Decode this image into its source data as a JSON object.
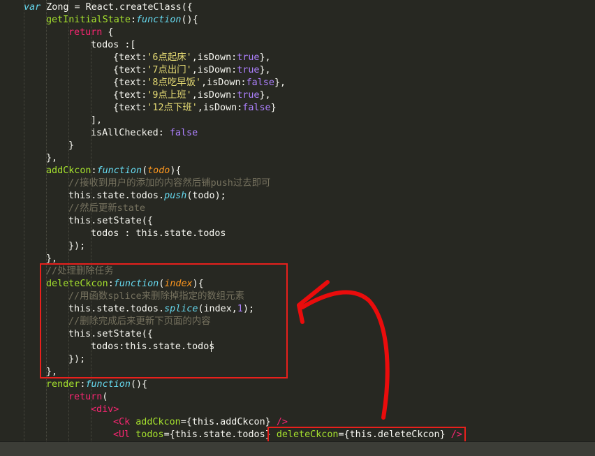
{
  "editor": {
    "theme_colors": {
      "background": "#272822",
      "keyword": "#f92672",
      "function_name": "#a6e22e",
      "string": "#e6db74",
      "constant": "#ae81ff",
      "comment": "#75715e",
      "parameter": "#fd971f",
      "storage": "#66d9ef",
      "annotation": "#e8201c"
    },
    "lines": [
      [
        [
          "st",
          "var"
        ],
        [
          "def",
          " Zong = React.createClass({"
        ]
      ],
      [
        [
          "fn",
          "getInitialState"
        ],
        [
          "def",
          ":"
        ],
        [
          "st",
          "function"
        ],
        [
          "def",
          "(){"
        ]
      ],
      [
        [
          "kw",
          "return"
        ],
        [
          "def",
          " {"
        ]
      ],
      [
        [
          "def",
          "todos :["
        ]
      ],
      [
        [
          "def",
          "{text:"
        ],
        [
          "str",
          "'6点起床'"
        ],
        [
          "def",
          ",isDown:"
        ],
        [
          "num",
          "true"
        ],
        [
          "def",
          "},"
        ]
      ],
      [
        [
          "def",
          "{text:"
        ],
        [
          "str",
          "'7点出门'"
        ],
        [
          "def",
          ",isDown:"
        ],
        [
          "num",
          "true"
        ],
        [
          "def",
          "},"
        ]
      ],
      [
        [
          "def",
          "{text:"
        ],
        [
          "str",
          "'8点吃早饭'"
        ],
        [
          "def",
          ",isDown:"
        ],
        [
          "num",
          "false"
        ],
        [
          "def",
          "},"
        ]
      ],
      [
        [
          "def",
          "{text:"
        ],
        [
          "str",
          "'9点上班'"
        ],
        [
          "def",
          ",isDown:"
        ],
        [
          "num",
          "true"
        ],
        [
          "def",
          "},"
        ]
      ],
      [
        [
          "def",
          "{text:"
        ],
        [
          "str",
          "'12点下班'"
        ],
        [
          "def",
          ",isDown:"
        ],
        [
          "num",
          "false"
        ],
        [
          "def",
          "}"
        ]
      ],
      [
        [
          "def",
          "],"
        ]
      ],
      [
        [
          "def",
          "isAllChecked: "
        ],
        [
          "num",
          "false"
        ]
      ],
      [
        [
          "def",
          "}"
        ]
      ],
      [
        [
          "def",
          "},"
        ]
      ],
      [
        [
          "fn",
          "addCkcon"
        ],
        [
          "def",
          ":"
        ],
        [
          "st",
          "function"
        ],
        [
          "def",
          "("
        ],
        [
          "par",
          "todo"
        ],
        [
          "def",
          "){"
        ]
      ],
      [
        [
          "cm",
          "//接收到用户的添加的内容然后铺push过去即可"
        ]
      ],
      [
        [
          "def",
          "this.state.todos."
        ],
        [
          "st",
          "push"
        ],
        [
          "def",
          "(todo);"
        ]
      ],
      [
        [
          "cm",
          "//然后更新state"
        ]
      ],
      [
        [
          "def",
          "this.setState({"
        ]
      ],
      [
        [
          "def",
          "todos : this.state.todos"
        ]
      ],
      [
        [
          "def",
          "});"
        ]
      ],
      [
        [
          "def",
          "},"
        ]
      ],
      [
        [
          "cm",
          "//处理删除任务"
        ]
      ],
      [
        [
          "fn",
          "deleteCkcon"
        ],
        [
          "def",
          ":"
        ],
        [
          "st",
          "function"
        ],
        [
          "def",
          "("
        ],
        [
          "par",
          "index"
        ],
        [
          "def",
          "){"
        ]
      ],
      [
        [
          "cm",
          "//用函数splice来删除掉指定的数组元素"
        ]
      ],
      [
        [
          "def",
          "this.state.todos."
        ],
        [
          "st",
          "splice"
        ],
        [
          "def",
          "(index,"
        ],
        [
          "num",
          "1"
        ],
        [
          "def",
          ");"
        ]
      ],
      [
        [
          "cm",
          "//删除完成后来更新下页面的内容"
        ]
      ],
      [
        [
          "def",
          "this.setState({"
        ]
      ],
      [
        [
          "def",
          "todos:this.state.todos"
        ]
      ],
      [
        [
          "def",
          "});"
        ]
      ],
      [
        [
          "def",
          "},"
        ]
      ],
      [
        [
          "fn",
          "render"
        ],
        [
          "def",
          ":"
        ],
        [
          "st",
          "function"
        ],
        [
          "def",
          "(){"
        ]
      ],
      [
        [
          "kw",
          "return"
        ],
        [
          "def",
          "("
        ]
      ],
      [
        [
          "tag",
          "<div>"
        ]
      ],
      [
        [
          "tag",
          "<Ck"
        ],
        [
          "def",
          " "
        ],
        [
          "attr",
          "addCkcon"
        ],
        [
          "def",
          "={this.addCkcon} "
        ],
        [
          "tag",
          "/>"
        ]
      ],
      [
        [
          "tag",
          "<Ul"
        ],
        [
          "def",
          " "
        ],
        [
          "attr",
          "todos"
        ],
        [
          "def",
          "={this.state.todos} "
        ],
        [
          "attr",
          "deleteCkcon"
        ],
        [
          "def",
          "={this.deleteCkcon} "
        ],
        [
          "tag",
          "/>"
        ]
      ]
    ]
  }
}
